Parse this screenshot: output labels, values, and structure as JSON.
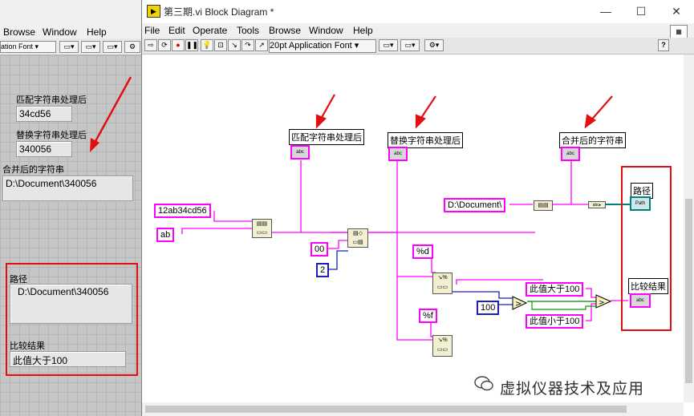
{
  "front_panel": {
    "menu": [
      "Browse",
      "Window",
      "Help"
    ],
    "font_dropdown": "ation Font",
    "controls": [
      {
        "label": "匹配字符串处理后",
        "value": "34cd56"
      },
      {
        "label": "替换字符串处理后",
        "value": "340056"
      },
      {
        "label": "合并后的字符串",
        "value": "D:\\Document\\340056"
      },
      {
        "label": "路径",
        "value": "D:\\Document\\340056"
      },
      {
        "label": "比较结果",
        "value": "此值大于100"
      }
    ]
  },
  "block_diagram": {
    "title": "第三期.vi Block Diagram *",
    "menu": [
      "File",
      "Edit",
      "Operate",
      "Tools",
      "Browse",
      "Window",
      "Help"
    ],
    "font_dropdown": "20pt Application Font",
    "indicator_labels": [
      "匹配字符串处理后",
      "替换字符串处理后",
      "合并后的字符串",
      "路径",
      "比较结果"
    ],
    "constants": [
      "12ab34cd56",
      "ab",
      "00",
      "2",
      "%d",
      "%f",
      "100",
      "此值大于100",
      "此值小于100",
      "D:\\Document\\"
    ],
    "terminal_icons": {
      "string": "abc",
      "path": "Path"
    }
  },
  "watermark": "虚拟仪器技术及应用",
  "colors": {
    "string_wire": "#ff00ff",
    "numeric_wire": "#1c1cbf",
    "path_wire": "#008080",
    "highlight": "#e01010"
  }
}
